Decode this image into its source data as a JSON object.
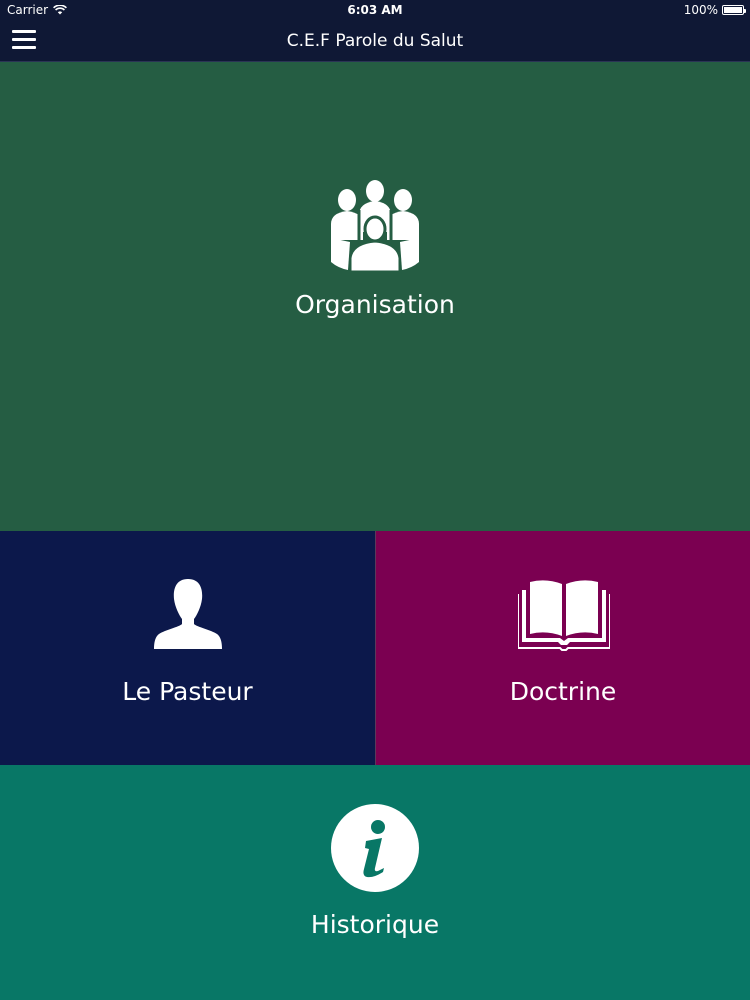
{
  "status_bar": {
    "carrier": "Carrier",
    "time": "6:03 AM",
    "battery": "100%"
  },
  "nav": {
    "title": "C.E.F Parole du Salut",
    "menu_icon": "hamburger-menu-icon"
  },
  "colors": {
    "nav_background": "#0f1835",
    "organisation": "#255d43",
    "pastor": "#0c184b",
    "doctrine": "#7b0051",
    "history": "#087766",
    "icon_fill": "#ffffff"
  },
  "tiles": {
    "organisation": {
      "label": "Organisation",
      "icon": "group-of-people-icon"
    },
    "pastor": {
      "label": "Le Pasteur",
      "icon": "person-silhouette-icon"
    },
    "doctrine": {
      "label": "Doctrine",
      "icon": "open-book-icon"
    },
    "history": {
      "label": "Historique",
      "icon": "info-circle-icon"
    }
  }
}
